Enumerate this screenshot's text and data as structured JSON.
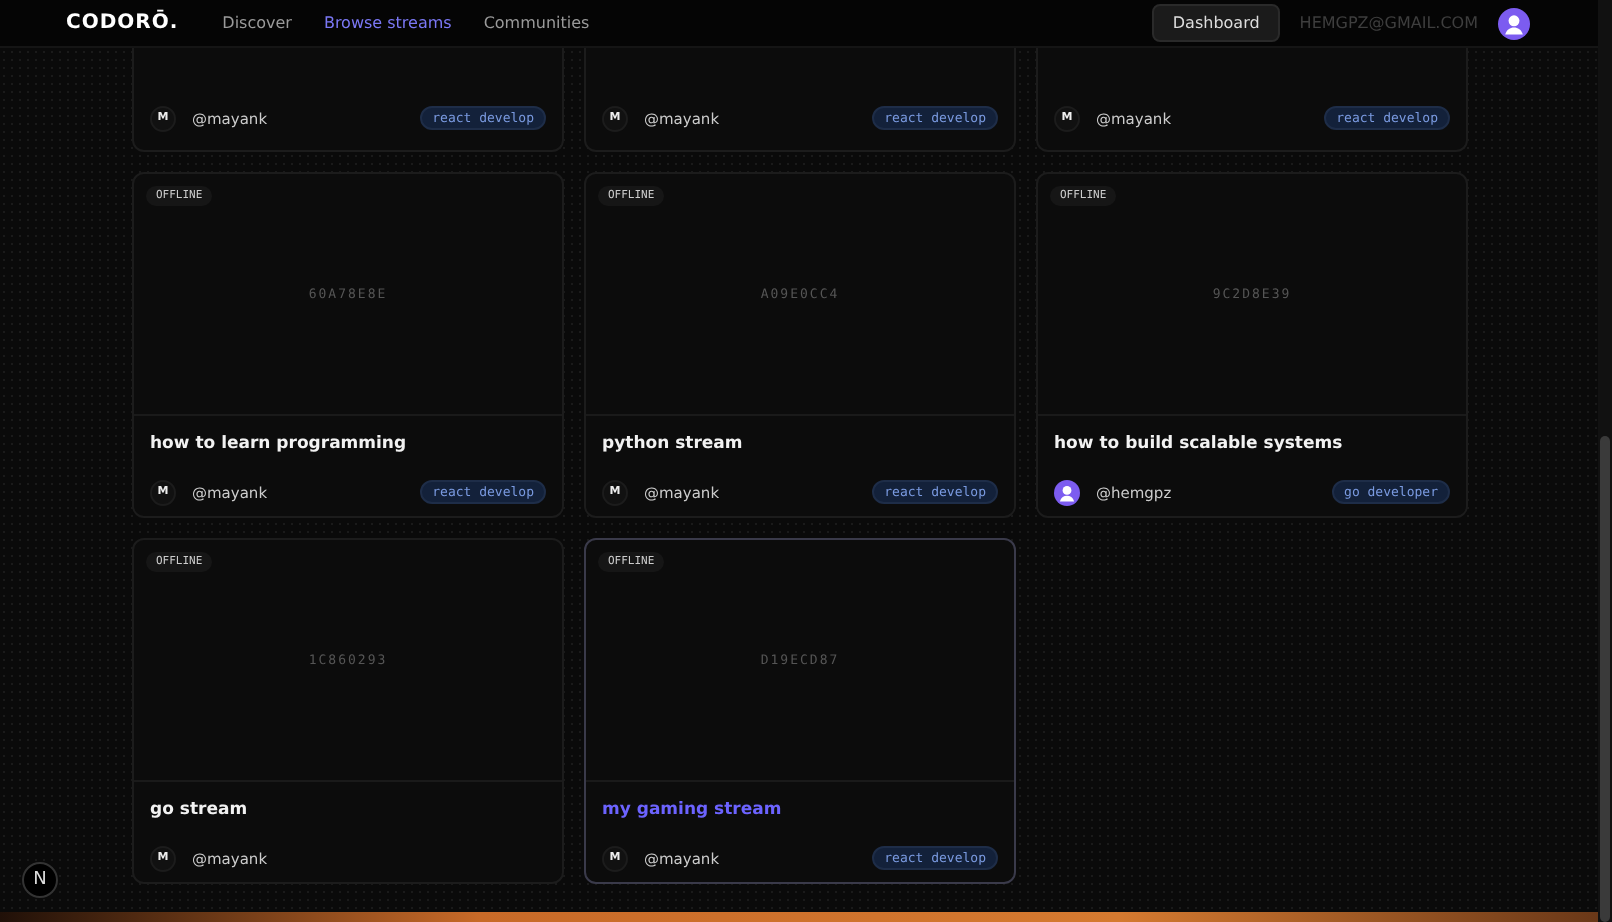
{
  "header": {
    "logo": "CODORŌ.",
    "nav": [
      {
        "label": "Discover",
        "selected": false
      },
      {
        "label": "Browse streams",
        "selected": true
      },
      {
        "label": "Communities",
        "selected": false
      }
    ],
    "dashboard_button": "Dashboard",
    "email": "HEMGPZ@GMAIL.COM"
  },
  "cut_cards": [
    {
      "avatar": {
        "kind": "initial",
        "text": "M"
      },
      "handle": "@mayank",
      "tag": "react develop"
    },
    {
      "avatar": {
        "kind": "initial",
        "text": "M"
      },
      "handle": "@mayank",
      "tag": "react develop"
    },
    {
      "avatar": {
        "kind": "initial",
        "text": "M"
      },
      "handle": "@mayank",
      "tag": "react develop"
    }
  ],
  "cards": [
    {
      "status": "OFFLINE",
      "code": "60A78E8E",
      "title": "how to learn programming",
      "selected": false,
      "avatar": {
        "kind": "initial",
        "text": "M"
      },
      "handle": "@mayank",
      "tag": "react develop"
    },
    {
      "status": "OFFLINE",
      "code": "A09E0CC4",
      "title": "python stream",
      "selected": false,
      "avatar": {
        "kind": "initial",
        "text": "M"
      },
      "handle": "@mayank",
      "tag": "react develop"
    },
    {
      "status": "OFFLINE",
      "code": "9C2D8E39",
      "title": "how to build scalable systems",
      "selected": false,
      "avatar": {
        "kind": "user"
      },
      "handle": "@hemgpz",
      "tag": "go developer"
    },
    {
      "status": "OFFLINE",
      "code": "1C860293",
      "title": "go stream",
      "selected": false,
      "avatar": {
        "kind": "initial",
        "text": "M"
      },
      "handle": "@mayank"
    },
    {
      "status": "OFFLINE",
      "code": "D19ECD87",
      "title": "my gaming stream",
      "selected": true,
      "avatar": {
        "kind": "initial",
        "text": "M"
      },
      "handle": "@mayank",
      "tag": "react develop"
    }
  ],
  "dev_badge": "N"
}
